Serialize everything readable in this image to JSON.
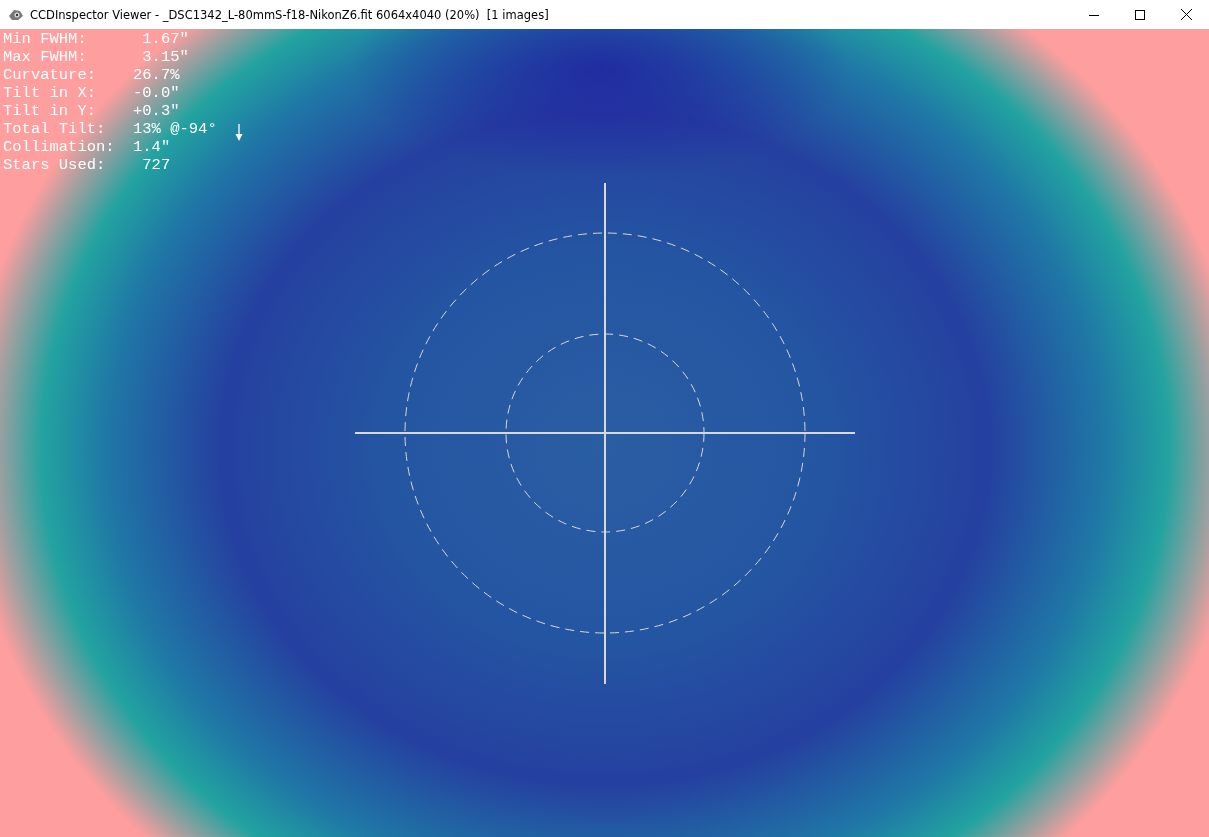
{
  "window": {
    "title": "CCDInspector Viewer - _DSC1342_L-80mmS-f18-NikonZ6.fit 6064x4040 (20%)  [1 images]"
  },
  "stats": [
    {
      "label": "Min FWHM:",
      "value": " 1.67\""
    },
    {
      "label": "Max FWHM:",
      "value": " 3.15\""
    },
    {
      "label": "Curvature:",
      "value": "26.7%"
    },
    {
      "label": "Tilt in X:",
      "value": "-0.0\""
    },
    {
      "label": "Tilt in Y:",
      "value": "+0.3\""
    },
    {
      "label": "Total Tilt:",
      "value": "13% @-94°",
      "arrow": true
    },
    {
      "label": "Collimation:",
      "value": "1.4\""
    },
    {
      "label": "Stars Used:",
      "value": " 727"
    }
  ]
}
